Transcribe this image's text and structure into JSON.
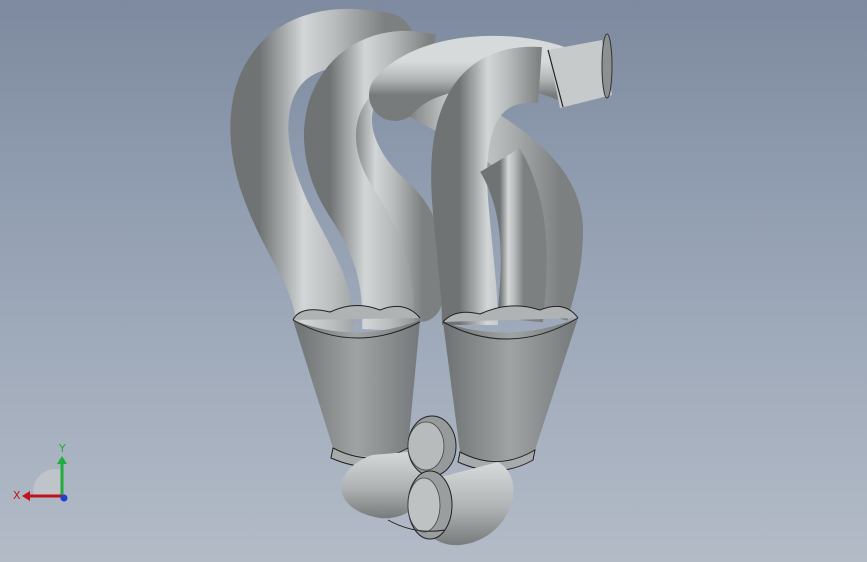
{
  "viewport": {
    "background_top": "#7d8a9f",
    "background_bottom": "#b3bbc7"
  },
  "model": {
    "kind": "exhaust-header",
    "color": "#b3b6b6"
  },
  "triad": {
    "x_label": "X",
    "y_label": "Y",
    "x_color": "#c0141a",
    "y_color": "#1fae3a",
    "z_color": "#1f3fd0"
  }
}
